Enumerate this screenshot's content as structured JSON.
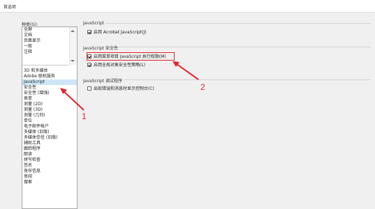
{
  "window": {
    "title": "首选项"
  },
  "categories": {
    "label": "种类(G):",
    "top_items": [
      "全屏",
      "文档",
      "页面显示",
      "一般",
      "注释"
    ],
    "items": [
      "3D 和多媒体",
      "Adobe 联机服务",
      "JavaScript",
      "安全性",
      "安全性 (增强)",
      "表单",
      "测量 (2D)",
      "测量 (3D)",
      "测量 (几何)",
      "单位",
      "电子邮件帐户",
      "多媒体 (旧版)",
      "多媒体信任 (旧版)",
      "辅助工具",
      "跟踪程序",
      "朗读",
      "拼写检查",
      "签名",
      "身份信息",
      "审阅",
      "搜索"
    ],
    "selected": "JavaScript"
  },
  "settings": {
    "javascript": {
      "title": "JavaScript",
      "enable_label": "启用 Acrobat JavaScript(J)",
      "enable_checked": true
    },
    "security": {
      "title": "JavaScript 安全性",
      "menu_privilege_label": "启用菜单项目 JavaScript 执行权限(M)",
      "menu_privilege_checked": true,
      "global_policy_label": "启用全局对象安全性策略(L)",
      "global_policy_checked": true
    },
    "debugger": {
      "title": "JavaScript 调试程序",
      "console_label": "出现错误和消息时显示控制台(C)",
      "console_checked": false
    }
  },
  "annotations": {
    "marker1": "1",
    "marker2": "2",
    "color": "#e0242d"
  }
}
